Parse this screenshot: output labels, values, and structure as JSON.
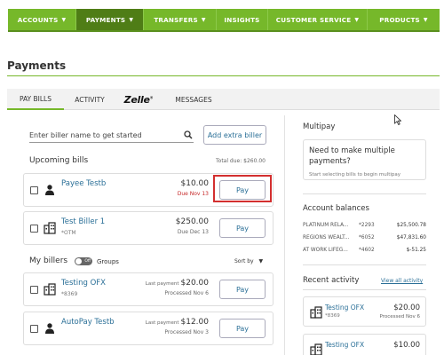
{
  "nav": {
    "items": [
      {
        "label": "ACCOUNTS"
      },
      {
        "label": "PAYMENTS"
      },
      {
        "label": "TRANSFERS"
      },
      {
        "label": "INSIGHTS"
      },
      {
        "label": "CUSTOMER SERVICE"
      },
      {
        "label": "PRODUCTS"
      }
    ],
    "active": "PAYMENTS"
  },
  "page": {
    "title": "Payments"
  },
  "tabs": [
    {
      "label": "PAY BILLS",
      "active": true
    },
    {
      "label": "ACTIVITY"
    },
    {
      "label": "Zelle"
    },
    {
      "label": "MESSAGES"
    }
  ],
  "search": {
    "placeholder": "Enter biller name to get started",
    "add_label": "Add extra biller"
  },
  "upcoming": {
    "title": "Upcoming bills",
    "total_due": "Total due: $260.00",
    "bills": [
      {
        "name": "Payee Testb",
        "sub": "",
        "amount": "$10.00",
        "date": "Due Nov 13",
        "overdue": true,
        "pay_label": "Pay",
        "icon": "person-icon"
      },
      {
        "name": "Test Biller 1",
        "sub": "*OTM",
        "amount": "$250.00",
        "date": "Due Dec 13",
        "overdue": false,
        "pay_label": "Pay",
        "icon": "building-icon"
      }
    ]
  },
  "my_billers": {
    "title": "My billers",
    "toggle_label": "Off",
    "groups_label": "Groups",
    "sort_label": "Sort by",
    "billers": [
      {
        "name": "Testing OFX",
        "sub": "*8369",
        "last_payment_label": "Last payment",
        "amount": "$20.00",
        "date": "Processed Nov 6",
        "pay_label": "Pay",
        "icon": "building-icon"
      },
      {
        "name": "AutoPay Testb",
        "sub": "",
        "last_payment_label": "Last payment",
        "amount": "$12.00",
        "date": "Processed Nov 3",
        "pay_label": "Pay",
        "icon": "person-icon"
      }
    ]
  },
  "multipay": {
    "title": "Multipay",
    "card_title": "Need to make multiple payments?",
    "card_sub": "Start selecting bills to begin multipay"
  },
  "balances": {
    "title": "Account balances",
    "rows": [
      {
        "name": "PLATINUM RELA...",
        "acct": "*2293",
        "amount": "$25,500.78"
      },
      {
        "name": "REGIONS WEALT...",
        "acct": "*6052",
        "amount": "$47,831.60"
      },
      {
        "name": "AT WORK LIFEG...",
        "acct": "*4602",
        "amount": "$-51.25"
      }
    ]
  },
  "recent": {
    "title": "Recent activity",
    "view_all": "View all activity",
    "items": [
      {
        "name": "Testing OFX",
        "sub": "*8369",
        "amount": "$20.00",
        "date": "Processed Nov 6"
      },
      {
        "name": "Testing OFX",
        "sub": "",
        "amount": "$10.00",
        "date": ""
      }
    ]
  },
  "colors": {
    "brand_green": "#76b82a",
    "active_green": "#4f7d16",
    "link_blue": "#2a6f97",
    "due_red": "#c62828",
    "highlight_red": "#d32f2f"
  }
}
